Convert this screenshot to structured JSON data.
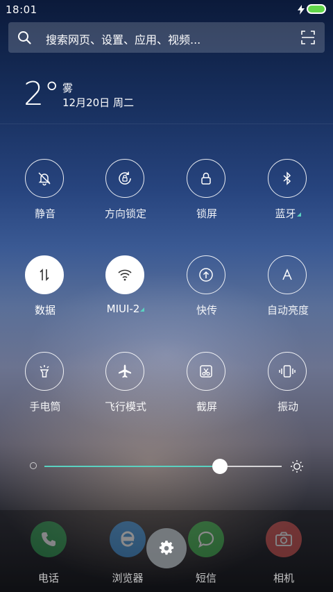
{
  "status": {
    "time": "18:01"
  },
  "search": {
    "placeholder": "搜索网页、设置、应用、视频..."
  },
  "weather": {
    "temp": "2°",
    "condition": "雾",
    "date": "12月20日 周二"
  },
  "toggles": [
    {
      "label": "静音",
      "on": false,
      "icon": "mute-bell-icon"
    },
    {
      "label": "方向锁定",
      "on": false,
      "icon": "rotation-lock-icon"
    },
    {
      "label": "锁屏",
      "on": false,
      "icon": "lock-icon"
    },
    {
      "label": "蓝牙",
      "on": false,
      "icon": "bluetooth-icon"
    },
    {
      "label": "数据",
      "on": true,
      "icon": "mobile-data-icon"
    },
    {
      "label": "MIUI-2",
      "on": true,
      "icon": "wifi-icon"
    },
    {
      "label": "快传",
      "on": false,
      "icon": "transfer-icon"
    },
    {
      "label": "自动亮度",
      "on": false,
      "icon": "auto-brightness-icon"
    },
    {
      "label": "手电筒",
      "on": false,
      "icon": "flashlight-icon"
    },
    {
      "label": "飞行模式",
      "on": false,
      "icon": "airplane-icon"
    },
    {
      "label": "截屏",
      "on": false,
      "icon": "screenshot-icon"
    },
    {
      "label": "振动",
      "on": false,
      "icon": "vibrate-icon"
    }
  ],
  "brightness": {
    "level": 0.74
  },
  "dock": [
    {
      "label": "电话",
      "icon": "phone-icon",
      "color": "#2e9e4f"
    },
    {
      "label": "浏览器",
      "icon": "browser-icon",
      "color": "#3a8fd6"
    },
    {
      "label": "短信",
      "icon": "sms-icon",
      "color": "#3bb24a"
    },
    {
      "label": "相机",
      "icon": "camera-icon",
      "color": "#d9534f"
    }
  ],
  "colors": {
    "accent": "#5ad2c1",
    "battery": "#61d64a"
  }
}
